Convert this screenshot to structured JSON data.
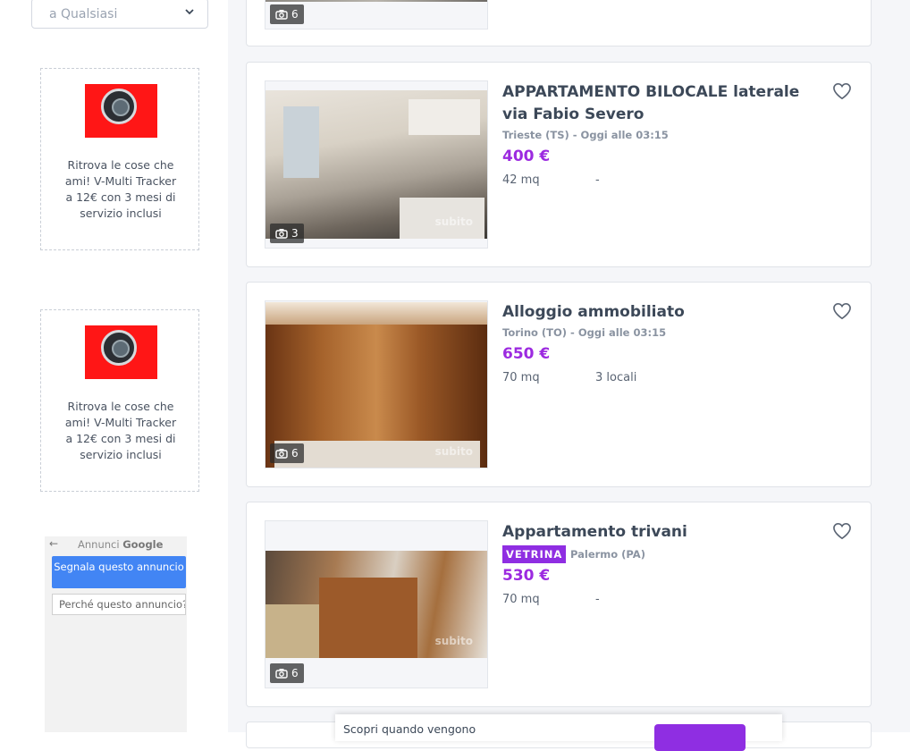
{
  "sidebar": {
    "price_select": {
      "value": "a Qualsiasi",
      "icon": "chevron-down-icon"
    },
    "ads": [
      {
        "text": "Ritrova le cose che ami! V-Multi Tracker a 12€ con 3 mesi di servizio inclusi"
      },
      {
        "text": "Ritrova le cose che ami! V-Multi Tracker a 12€ con 3 mesi di servizio inclusi"
      }
    ],
    "google_ads": {
      "label": "Annunci",
      "brand": "Google",
      "report_button": "Segnala questo annuncio",
      "why_button": "Perché questo annuncio?"
    }
  },
  "listings": [
    {
      "photo_count": "6"
    },
    {
      "title": "APPARTAMENTO BILOCALE laterale via Fabio Severo",
      "location_time": "Trieste (TS) - Oggi alle 03:15",
      "price": "400 €",
      "size": "42 mq",
      "rooms": "-",
      "photo_count": "3",
      "watermark": "subito"
    },
    {
      "title": "Alloggio ammobiliato",
      "location_time": "Torino (TO) - Oggi alle 03:15",
      "price": "650 €",
      "size": "70 mq",
      "rooms": "3 locali",
      "photo_count": "6",
      "watermark": "subito"
    },
    {
      "title": "Appartamento trivani",
      "badge": "VETRINA",
      "location": "Palermo (PA)",
      "price": "530 €",
      "size": "70 mq",
      "rooms": "-",
      "photo_count": "6",
      "watermark": "subito"
    }
  ],
  "popup": {
    "text": "Scopri quando vengono"
  },
  "colors": {
    "accent": "#9c2ae0",
    "vetrina": "#8f2ee2",
    "ad_red": "#ff1616",
    "google_blue": "#4285f4"
  }
}
